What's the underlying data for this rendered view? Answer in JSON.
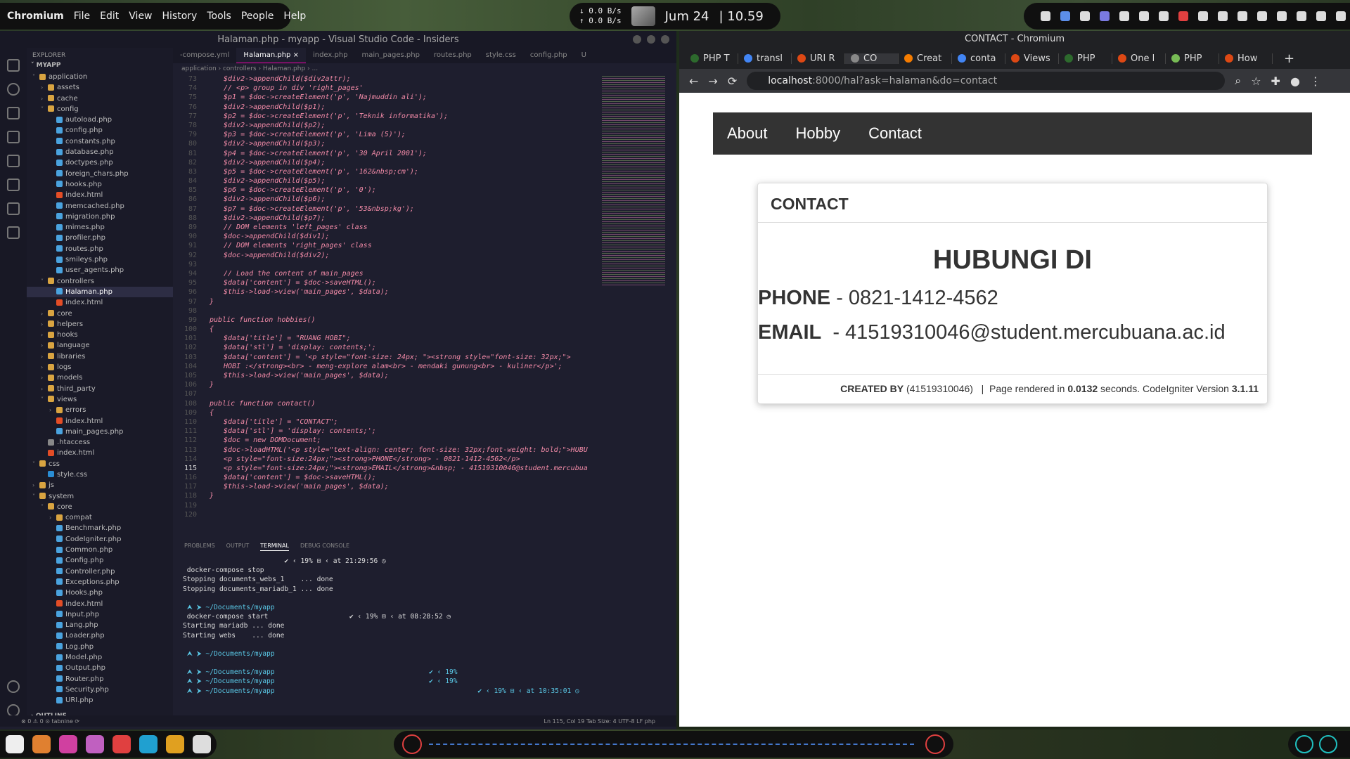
{
  "topbar": {
    "app": "Chromium",
    "menus": [
      "File",
      "Edit",
      "View",
      "History",
      "Tools",
      "People",
      "Help"
    ],
    "net_down": "0.0 B/s",
    "net_up": "0.0 B/s",
    "date": "Jum 24",
    "time": "| 10.59"
  },
  "vscode": {
    "title": "Halaman.php - myapp - Visual Studio Code - Insiders",
    "explorer_header": "EXPLORER",
    "project": "MYAPP",
    "tree": [
      {
        "g": "˅",
        "i": "folder",
        "t": "application",
        "d": 0
      },
      {
        "g": "›",
        "i": "folder",
        "t": "assets",
        "d": 1
      },
      {
        "g": "›",
        "i": "folder",
        "t": "cache",
        "d": 1
      },
      {
        "g": "˅",
        "i": "folder",
        "t": "config",
        "d": 1
      },
      {
        "g": "",
        "i": "php",
        "t": "autoload.php",
        "d": 2
      },
      {
        "g": "",
        "i": "php",
        "t": "config.php",
        "d": 2
      },
      {
        "g": "",
        "i": "php",
        "t": "constants.php",
        "d": 2
      },
      {
        "g": "",
        "i": "php",
        "t": "database.php",
        "d": 2
      },
      {
        "g": "",
        "i": "php",
        "t": "doctypes.php",
        "d": 2
      },
      {
        "g": "",
        "i": "php",
        "t": "foreign_chars.php",
        "d": 2
      },
      {
        "g": "",
        "i": "php",
        "t": "hooks.php",
        "d": 2
      },
      {
        "g": "",
        "i": "html",
        "t": "index.html",
        "d": 2
      },
      {
        "g": "",
        "i": "php",
        "t": "memcached.php",
        "d": 2
      },
      {
        "g": "",
        "i": "php",
        "t": "migration.php",
        "d": 2
      },
      {
        "g": "",
        "i": "php",
        "t": "mimes.php",
        "d": 2
      },
      {
        "g": "",
        "i": "php",
        "t": "profiler.php",
        "d": 2
      },
      {
        "g": "",
        "i": "php",
        "t": "routes.php",
        "d": 2
      },
      {
        "g": "",
        "i": "php",
        "t": "smileys.php",
        "d": 2
      },
      {
        "g": "",
        "i": "php",
        "t": "user_agents.php",
        "d": 2
      },
      {
        "g": "˅",
        "i": "folder",
        "t": "controllers",
        "d": 1
      },
      {
        "g": "",
        "i": "php",
        "t": "Halaman.php",
        "d": 2,
        "sel": true
      },
      {
        "g": "",
        "i": "html",
        "t": "index.html",
        "d": 2
      },
      {
        "g": "›",
        "i": "folder",
        "t": "core",
        "d": 1
      },
      {
        "g": "›",
        "i": "folder",
        "t": "helpers",
        "d": 1
      },
      {
        "g": "›",
        "i": "folder",
        "t": "hooks",
        "d": 1
      },
      {
        "g": "›",
        "i": "folder",
        "t": "language",
        "d": 1
      },
      {
        "g": "›",
        "i": "folder",
        "t": "libraries",
        "d": 1
      },
      {
        "g": "›",
        "i": "folder",
        "t": "logs",
        "d": 1
      },
      {
        "g": "›",
        "i": "folder",
        "t": "models",
        "d": 1
      },
      {
        "g": "›",
        "i": "folder",
        "t": "third_party",
        "d": 1
      },
      {
        "g": "˅",
        "i": "folder",
        "t": "views",
        "d": 1
      },
      {
        "g": "›",
        "i": "folder",
        "t": "errors",
        "d": 2
      },
      {
        "g": "",
        "i": "html",
        "t": "index.html",
        "d": 2
      },
      {
        "g": "",
        "i": "php",
        "t": "main_pages.php",
        "d": 2
      },
      {
        "g": "",
        "i": "file",
        "t": ".htaccess",
        "d": 1
      },
      {
        "g": "",
        "i": "html",
        "t": "index.html",
        "d": 1
      },
      {
        "g": "˅",
        "i": "folder",
        "t": "css",
        "d": 0
      },
      {
        "g": "",
        "i": "css",
        "t": "style.css",
        "d": 1
      },
      {
        "g": "›",
        "i": "folder",
        "t": "js",
        "d": 0
      },
      {
        "g": "˅",
        "i": "folder",
        "t": "system",
        "d": 0
      },
      {
        "g": "˅",
        "i": "folder",
        "t": "core",
        "d": 1
      },
      {
        "g": "›",
        "i": "folder",
        "t": "compat",
        "d": 2
      },
      {
        "g": "",
        "i": "php",
        "t": "Benchmark.php",
        "d": 2
      },
      {
        "g": "",
        "i": "php",
        "t": "CodeIgniter.php",
        "d": 2
      },
      {
        "g": "",
        "i": "php",
        "t": "Common.php",
        "d": 2
      },
      {
        "g": "",
        "i": "php",
        "t": "Config.php",
        "d": 2
      },
      {
        "g": "",
        "i": "php",
        "t": "Controller.php",
        "d": 2
      },
      {
        "g": "",
        "i": "php",
        "t": "Exceptions.php",
        "d": 2
      },
      {
        "g": "",
        "i": "php",
        "t": "Hooks.php",
        "d": 2
      },
      {
        "g": "",
        "i": "html",
        "t": "index.html",
        "d": 2
      },
      {
        "g": "",
        "i": "php",
        "t": "Input.php",
        "d": 2
      },
      {
        "g": "",
        "i": "php",
        "t": "Lang.php",
        "d": 2
      },
      {
        "g": "",
        "i": "php",
        "t": "Loader.php",
        "d": 2
      },
      {
        "g": "",
        "i": "php",
        "t": "Log.php",
        "d": 2
      },
      {
        "g": "",
        "i": "php",
        "t": "Model.php",
        "d": 2
      },
      {
        "g": "",
        "i": "php",
        "t": "Output.php",
        "d": 2
      },
      {
        "g": "",
        "i": "php",
        "t": "Router.php",
        "d": 2
      },
      {
        "g": "",
        "i": "php",
        "t": "Security.php",
        "d": 2
      },
      {
        "g": "",
        "i": "php",
        "t": "URI.php",
        "d": 2
      }
    ],
    "outline": "OUTLINE",
    "tabs": [
      "-compose.yml",
      "Halaman.php ×",
      "index.php",
      "main_pages.php",
      "routes.php",
      "style.css",
      "config.php",
      "U"
    ],
    "breadcrumb": "application › controllers › Halaman.php › ...",
    "code": [
      [
        "73",
        "$div2->appendChild($div2attr);"
      ],
      [
        "74",
        "// <p> group in div 'right_pages'"
      ],
      [
        "75",
        "$p1 = $doc->createElement('p', 'Najmuddin ali');"
      ],
      [
        "76",
        "$div2->appendChild($p1);"
      ],
      [
        "77",
        "$p2 = $doc->createElement('p', 'Teknik informatika');"
      ],
      [
        "78",
        "$div2->appendChild($p2);"
      ],
      [
        "79",
        "$p3 = $doc->createElement('p', 'Lima (5)');"
      ],
      [
        "80",
        "$div2->appendChild($p3);"
      ],
      [
        "81",
        "$p4 = $doc->createElement('p', '30 April 2001');"
      ],
      [
        "82",
        "$div2->appendChild($p4);"
      ],
      [
        "83",
        "$p5 = $doc->createElement('p', '162&nbsp;cm');"
      ],
      [
        "84",
        "$div2->appendChild($p5);"
      ],
      [
        "85",
        "$p6 = $doc->createElement('p', '0');"
      ],
      [
        "86",
        "$div2->appendChild($p6);"
      ],
      [
        "87",
        "$p7 = $doc->createElement('p', '53&nbsp;kg');"
      ],
      [
        "88",
        "$div2->appendChild($p7);"
      ],
      [
        "89",
        "// DOM elements 'left_pages' class"
      ],
      [
        "90",
        "$doc->appendChild($div1);"
      ],
      [
        "91",
        "// DOM elements 'right_pages' class"
      ],
      [
        "92",
        "$doc->appendChild($div2);"
      ],
      [
        "93",
        ""
      ],
      [
        "94",
        "// Load the content of main_pages"
      ],
      [
        "95",
        "$data['content'] = $doc->saveHTML();"
      ],
      [
        "96",
        "$this->load->view('main_pages', $data);"
      ],
      [
        "97",
        "}"
      ],
      [
        "98",
        ""
      ],
      [
        "99",
        "public function hobbies()"
      ],
      [
        "100",
        "{"
      ],
      [
        "101",
        "$data['title'] = \"RUANG HOBI\";"
      ],
      [
        "102",
        "$data['stl'] = 'display: contents;';"
      ],
      [
        "103",
        "$data['content'] = '<p style=\"font-size: 24px; \"><strong style=\"font-size: 32px;\">"
      ],
      [
        "104",
        "HOBI :</strong><br> - meng-explore alam<br> - mendaki gunung<br> - kuliner</p>';"
      ],
      [
        "105",
        "$this->load->view('main_pages', $data);"
      ],
      [
        "106",
        "}"
      ],
      [
        "107",
        ""
      ],
      [
        "108",
        "public function contact()"
      ],
      [
        "109",
        "{"
      ],
      [
        "110",
        "$data['title'] = \"CONTACT\";"
      ],
      [
        "111",
        "$data['stl'] = 'display: contents;';"
      ],
      [
        "112",
        "$doc = new DOMDocument;"
      ],
      [
        "113",
        "$doc->loadHTML('<p style=\"text-align: center; font-size: 32px;font-weight: bold;\">HUBU"
      ],
      [
        "114",
        "<p style=\"font-size:24px;\"><strong>PHONE</strong> - 0821-1412-4562</p>"
      ],
      [
        "115",
        "<p style=\"font-size:24px;\"><strong>EMAIL</strong>&nbsp; - 41519310046@student.mercubua"
      ],
      [
        "116",
        "$data['content'] = $doc->saveHTML();"
      ],
      [
        "117",
        "$this->load->view('main_pages', $data);"
      ],
      [
        "118",
        "}"
      ],
      [
        "119",
        ""
      ],
      [
        "120",
        ""
      ]
    ],
    "panel_tabs": [
      "PROBLEMS",
      "OUTPUT",
      "TERMINAL",
      "DEBUG CONSOLE"
    ],
    "terminal": [
      "                         ✔ ‹ 19% ⊟ ‹ at 21:29:56 ◷",
      " docker-compose stop",
      "Stopping documents_webs_1    ... done",
      "Stopping documents_mariadb_1 ... done",
      "",
      " ⮝ ⮞ ~/Documents/myapp",
      " docker-compose start                    ✔ ‹ 19% ⊟ ‹ at 08:28:52 ◷",
      "Starting mariadb ... done",
      "Starting webs    ... done",
      "",
      " ⮝ ⮞ ~/Documents/myapp",
      "",
      " ⮝ ⮞ ~/Documents/myapp                                      ✔ ‹ 19%",
      " ⮝ ⮞ ~/Documents/myapp                                      ✔ ‹ 19%",
      " ⮝ ⮞ ~/Documents/myapp                                                  ✔ ‹ 19% ⊟ ‹ at 10:35:01 ◷"
    ],
    "status_left": "⊗ 0 ⚠ 0   ⊙ tabnine ⟳",
    "status_right": "Ln 115, Col 19   Tab Size: 4   UTF-8   LF   php"
  },
  "chrome": {
    "title": "CONTACT - Chromium",
    "tabs": [
      {
        "t": "PHP T",
        "c": "#2d6a2d"
      },
      {
        "t": "transl",
        "c": "#4285f4"
      },
      {
        "t": "URI R",
        "c": "#dd4814"
      },
      {
        "t": "CO",
        "c": "#888",
        "act": true
      },
      {
        "t": "Creat",
        "c": "#f57c00"
      },
      {
        "t": "conta",
        "c": "#4285f4"
      },
      {
        "t": "Views",
        "c": "#dd4814"
      },
      {
        "t": "PHP",
        "c": "#2d6a2d"
      },
      {
        "t": "One l",
        "c": "#dd4814"
      },
      {
        "t": "PHP",
        "c": "#7b5"
      },
      {
        "t": "How",
        "c": "#dd4814"
      }
    ],
    "url_host": "localhost",
    "url_rest": ":8000/hal?ask=halaman&do=contact",
    "nav": [
      "About",
      "Hobby",
      "Contact"
    ],
    "card": {
      "title": "CONTACT",
      "heading": "HUBUNGI DI",
      "phone_label": "PHONE",
      "phone": " - 0821-1412-4562",
      "email_label": "EMAIL",
      "email": "  - 41519310046@student.mercubuana.ac.id",
      "footer_created": "CREATED BY",
      "footer_id": " (41519310046)",
      "footer_sep": "   |  Page rendered in ",
      "footer_time": "0.0132",
      "footer_sec": " seconds. CodeIgniter Version ",
      "footer_ver": "3.1.11"
    }
  }
}
